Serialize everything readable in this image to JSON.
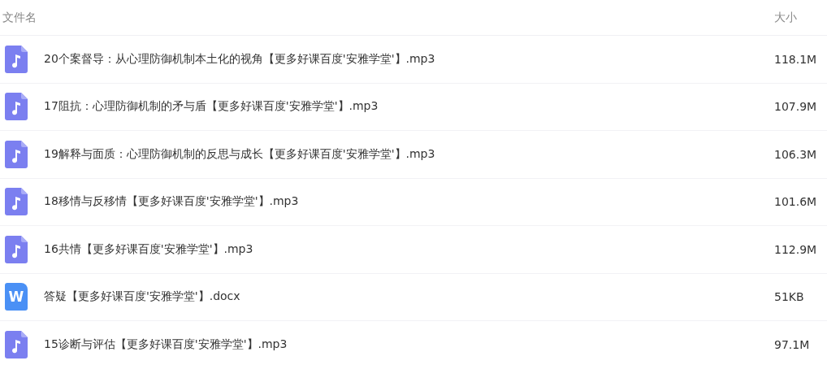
{
  "table": {
    "columns": [
      "文件名",
      "大小"
    ],
    "rows": [
      {
        "kind": "audio",
        "name": "20个案督导：从心理防御机制本土化的视角【更多好课百度'安雅学堂'】.mp3",
        "size": "118.1M"
      },
      {
        "kind": "audio",
        "name": "17阻抗：心理防御机制的矛与盾【更多好课百度'安雅学堂'】.mp3",
        "size": "107.9M"
      },
      {
        "kind": "audio",
        "name": "19解释与面质：心理防御机制的反思与成长【更多好课百度'安雅学堂'】.mp3",
        "size": "106.3M"
      },
      {
        "kind": "audio",
        "name": "18移情与反移情【更多好课百度'安雅学堂'】.mp3",
        "size": "101.6M"
      },
      {
        "kind": "audio",
        "name": "16共情【更多好课百度'安雅学堂'】.mp3",
        "size": "112.9M"
      },
      {
        "kind": "doc",
        "icon_text": "W",
        "name": "答疑【更多好课百度'安雅学堂'】.docx",
        "size": "51KB"
      },
      {
        "kind": "audio",
        "name": "15诊断与评估【更多好课百度'安雅学堂'】.mp3",
        "size": "97.1M"
      }
    ]
  }
}
